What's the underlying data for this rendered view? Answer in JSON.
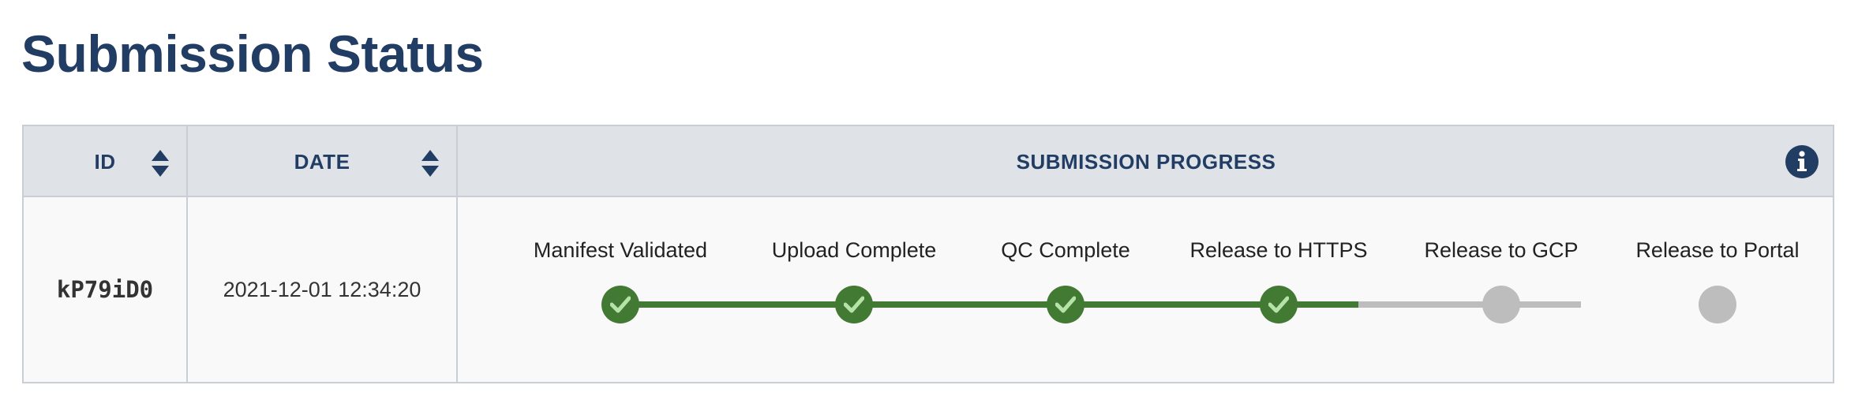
{
  "page": {
    "title": "Submission Status"
  },
  "table": {
    "columns": {
      "id": "ID",
      "date": "DATE",
      "progress": "SUBMISSION PROGRESS"
    },
    "row": {
      "id": "kP79iD0",
      "date": "2021-12-01 12:34:20"
    },
    "steps": [
      {
        "label": "Manifest Validated",
        "status": "complete"
      },
      {
        "label": "Upload Complete",
        "status": "complete"
      },
      {
        "label": "QC Complete",
        "status": "complete"
      },
      {
        "label": "Release to HTTPS",
        "status": "complete"
      },
      {
        "label": "Release to GCP",
        "status": "pending"
      },
      {
        "label": "Release to Portal",
        "status": "pending"
      }
    ]
  },
  "icons": {
    "sort": "sort-updown-icon",
    "info": "info-circle-icon",
    "check": "check-icon"
  },
  "colors": {
    "title": "#223d63",
    "header_bg": "#dfe2e7",
    "complete": "#437a33",
    "pending": "#bdbdbd",
    "check": "#b6e3a8"
  }
}
